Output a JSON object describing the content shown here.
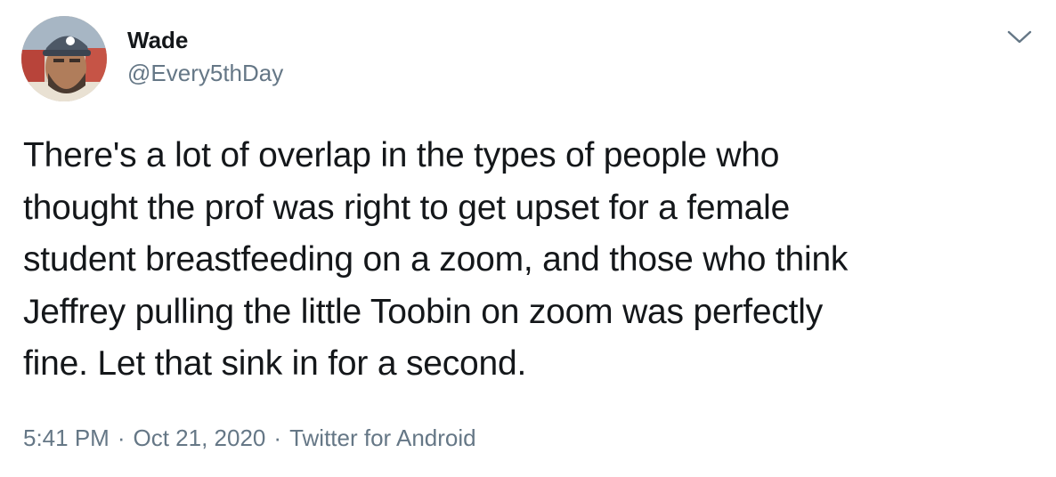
{
  "author": {
    "display_name": "Wade",
    "handle": "@Every5thDay"
  },
  "icons": {
    "avatar": "avatar-photo",
    "menu": "chevron-down-icon"
  },
  "tweet": {
    "lines": [
      "There's a lot of overlap in the types of people who",
      "thought the prof was right to get upset for a female",
      "student breastfeeding on a zoom, and those who think",
      "Jeffrey pulling the little Toobin on zoom was perfectly",
      "fine. Let that sink in for a second."
    ]
  },
  "meta": {
    "time": "5:41 PM",
    "separator": "·",
    "date": "Oct 21, 2020",
    "source": "Twitter for Android"
  },
  "colors": {
    "text": "#14171a",
    "secondary": "#657786",
    "background": "#ffffff"
  }
}
